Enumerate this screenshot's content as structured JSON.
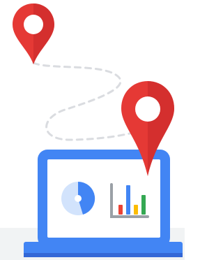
{
  "illustration": {
    "subject": "location-to-analytics",
    "icons": [
      "map-pin-icon",
      "map-pin-icon",
      "laptop-icon",
      "pie-chart-icon",
      "bar-chart-icon"
    ]
  },
  "colors": {
    "pin_red": "#e53935",
    "pin_dark_red": "#c62828",
    "pin_center": "#ffffff",
    "laptop_blue": "#4285f4",
    "laptop_dark_blue": "#3367d6",
    "screen": "#ffffff",
    "pie_light": "#d2e3fc",
    "pie_dark": "#4285f4",
    "path_dash": "#dadce0",
    "axis": "#9aa0a6",
    "floor": "#f1f3f4",
    "bar_red": "#ea4335",
    "bar_blue": "#4285f4",
    "bar_yellow": "#fbbc04",
    "bar_green": "#34a853"
  },
  "chart_data": {
    "type": "bar",
    "values": [
      1,
      3,
      1,
      2
    ],
    "bar_colors": [
      "bar_red",
      "bar_blue",
      "bar_yellow",
      "bar_green"
    ]
  }
}
